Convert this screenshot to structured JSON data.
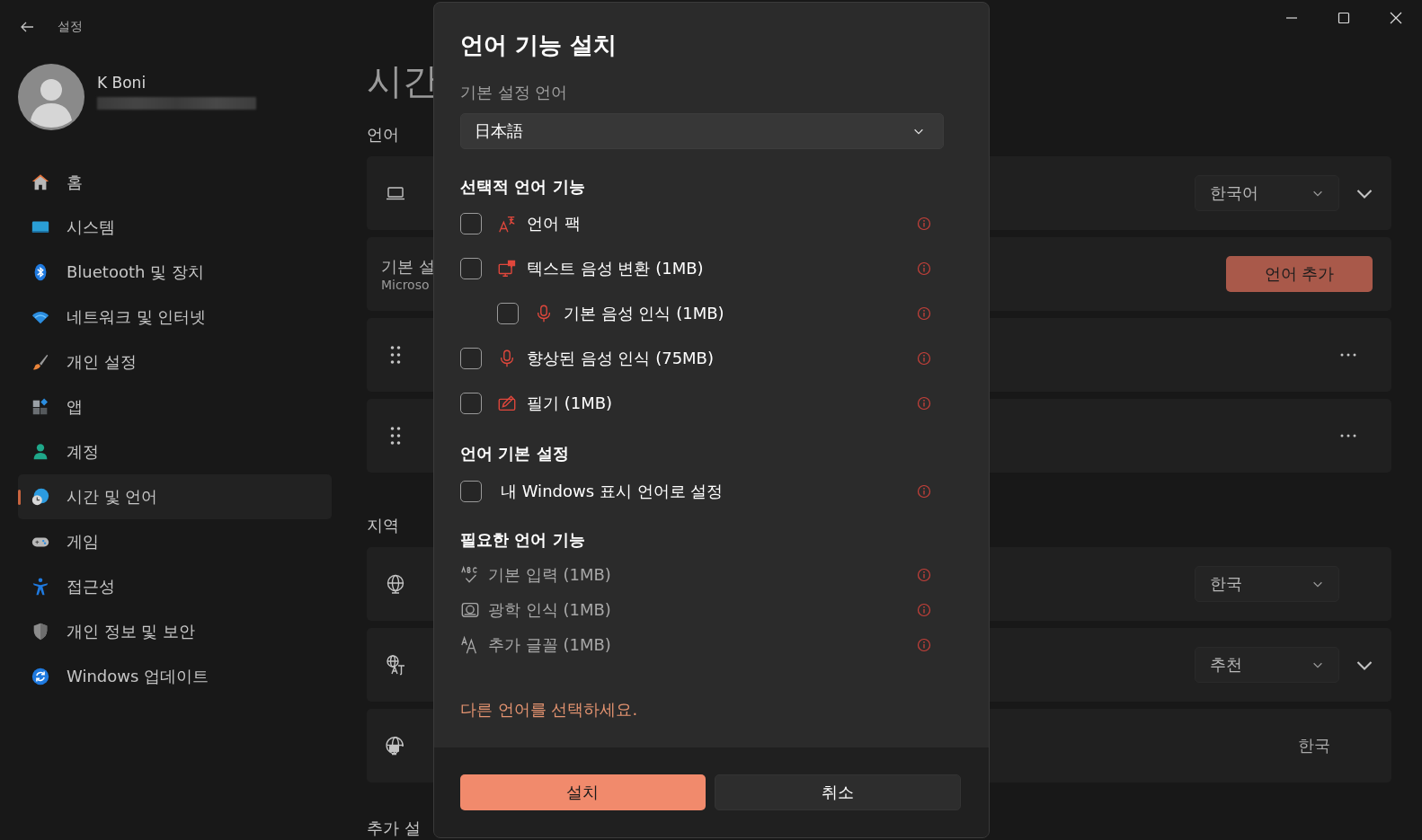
{
  "window": {
    "title": "설정"
  },
  "account": {
    "name": "K Boni"
  },
  "sidebar": {
    "items": [
      {
        "label": "홈",
        "selected": false
      },
      {
        "label": "시스템",
        "selected": false
      },
      {
        "label": "Bluetooth 및 장치",
        "selected": false
      },
      {
        "label": "네트워크 및 인터넷",
        "selected": false
      },
      {
        "label": "개인 설정",
        "selected": false
      },
      {
        "label": "앱",
        "selected": false
      },
      {
        "label": "계정",
        "selected": false
      },
      {
        "label": "시간 및 언어",
        "selected": true
      },
      {
        "label": "게임",
        "selected": false
      },
      {
        "label": "접근성",
        "selected": false
      },
      {
        "label": "개인 정보 및 보안",
        "selected": false
      },
      {
        "label": "Windows 업데이트",
        "selected": false
      }
    ]
  },
  "page": {
    "title": "시간",
    "sections": [
      {
        "heading": "언어",
        "cards": [
          {
            "kind": "dropdown",
            "dropdown": "한국어",
            "expandable": true
          },
          {
            "kind": "button",
            "title": "기본 설",
            "subtitle": "Microso",
            "button": "언어 추가"
          },
          {
            "kind": "drag"
          },
          {
            "kind": "drag"
          }
        ]
      },
      {
        "heading": "지역",
        "cards": [
          {
            "kind": "dropdown",
            "dropdown": "한국",
            "expandable": false
          },
          {
            "kind": "dropdown",
            "dropdown": "추천",
            "expandable": true
          },
          {
            "kind": "value",
            "value": "한국"
          }
        ]
      }
    ],
    "footer_heading": "추가 설"
  },
  "dialog": {
    "title": "언어 기능 설치",
    "preferred_label": "기본 설정 언어",
    "preferred_value": "日本語",
    "optional_heading": "선택적 언어 기능",
    "optional": [
      {
        "label": "언어 팩",
        "checked": false
      },
      {
        "label": "텍스트 음성 변환 (1MB)",
        "checked": false,
        "children": [
          {
            "label": "기본 음성 인식 (1MB)",
            "checked": false
          }
        ]
      },
      {
        "label": "향상된 음성 인식 (75MB)",
        "checked": false
      },
      {
        "label": "필기 (1MB)",
        "checked": false
      }
    ],
    "preference_heading": "언어 기본 설정",
    "preferences": [
      {
        "label": "내 Windows 표시 언어로 설정",
        "checked": false
      }
    ],
    "required_heading": "필요한 언어 기능",
    "required": [
      {
        "label": "기본 입력 (1MB)"
      },
      {
        "label": "광학 인식 (1MB)"
      },
      {
        "label": "추가 글꼴 (1MB)"
      }
    ],
    "link": "다른 언어를 선택하세요.",
    "buttons": [
      {
        "label": "설치",
        "kind": "primary"
      },
      {
        "label": "취소",
        "kind": "secondary"
      }
    ]
  }
}
